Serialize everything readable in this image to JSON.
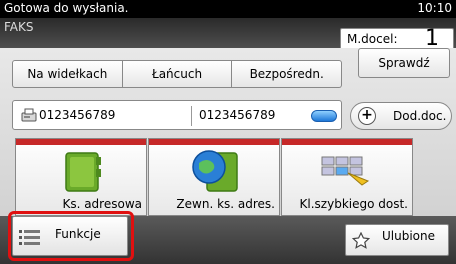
{
  "status": {
    "text": "Gotowa do wysłania.",
    "time": "10:10"
  },
  "title": "FAKS",
  "copies": {
    "label": "M.docel:",
    "value": "1"
  },
  "check_button": "Sprawdź",
  "tabs": [
    "Na widełkach",
    "Łańcuch",
    "Bezpośredn."
  ],
  "destinations": {
    "first": "0123456789",
    "second": "0123456789"
  },
  "add_destination": "Dod.doc.",
  "address_books": [
    {
      "label": "Ks. adresowa",
      "icon": "address-book-icon"
    },
    {
      "label": "Zewn. ks. adres.",
      "icon": "external-address-book-icon"
    },
    {
      "label": "Kl.szybkiego dost.",
      "icon": "one-touch-key-icon"
    }
  ],
  "functions_button": "Funkcje",
  "favorites_button": "Ulubione",
  "colors": {
    "highlight": "#e01010",
    "stripe": "#c62828",
    "accent_blue": "#1e78d8"
  }
}
